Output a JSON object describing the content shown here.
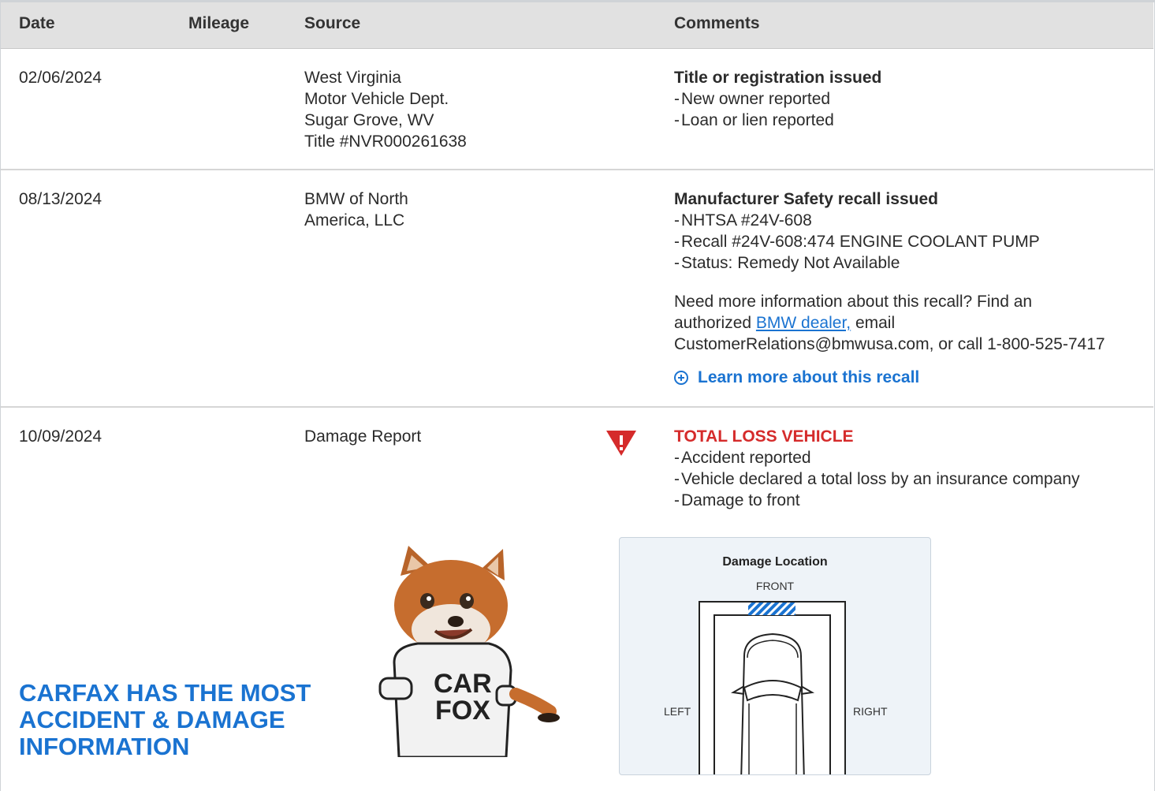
{
  "table": {
    "headers": [
      "Date",
      "Mileage",
      "Source",
      "Comments"
    ]
  },
  "rows": [
    {
      "date": "02/06/2024",
      "mileage": "",
      "source": [
        "West Virginia",
        "Motor Vehicle Dept.",
        "Sugar Grove, WV",
        "Title #NVR000261638"
      ],
      "comment_title": "Title or registration issued",
      "bullets": [
        "New owner reported",
        "Loan or lien reported"
      ]
    },
    {
      "date": "08/13/2024",
      "mileage": "",
      "source": [
        "BMW of North",
        "America, LLC"
      ],
      "comment_title": "Manufacturer Safety recall issued",
      "bullets": [
        "NHTSA #24V-608",
        "Recall #24V-608:474 ENGINE COOLANT PUMP",
        "Status: Remedy Not Available"
      ],
      "info_text_1": "Need more information about this recall? Find an",
      "info_text_2_pre": "authorized ",
      "info_link": "BMW dealer,",
      "info_text_2_post": " email",
      "info_text_3": "CustomerRelations@bmwusa.com, or call 1-800-525-7417",
      "learn_more": "Learn more about this recall"
    },
    {
      "date": "10/09/2024",
      "mileage": "",
      "source": [
        "Damage Report"
      ],
      "comment_title": "TOTAL LOSS VEHICLE",
      "bullets": [
        "Accident reported",
        "Vehicle declared a total loss by an insurance company",
        "Damage to front"
      ],
      "alert_icon": "alert-triangle-icon"
    }
  ],
  "damage_diagram": {
    "title": "Damage Location",
    "front": "FRONT",
    "left": "LEFT",
    "right": "RIGHT",
    "damaged_zone": "front"
  },
  "promo": {
    "line1": "CARFAX HAS THE MOST",
    "line2": "ACCIDENT & DAMAGE",
    "line3": "INFORMATION",
    "shirt_line1": "CAR",
    "shirt_line2": "FOX"
  },
  "colors": {
    "accent": "#1a73d1",
    "alert": "#d52b2b",
    "header_bg": "#e1e1e1"
  }
}
